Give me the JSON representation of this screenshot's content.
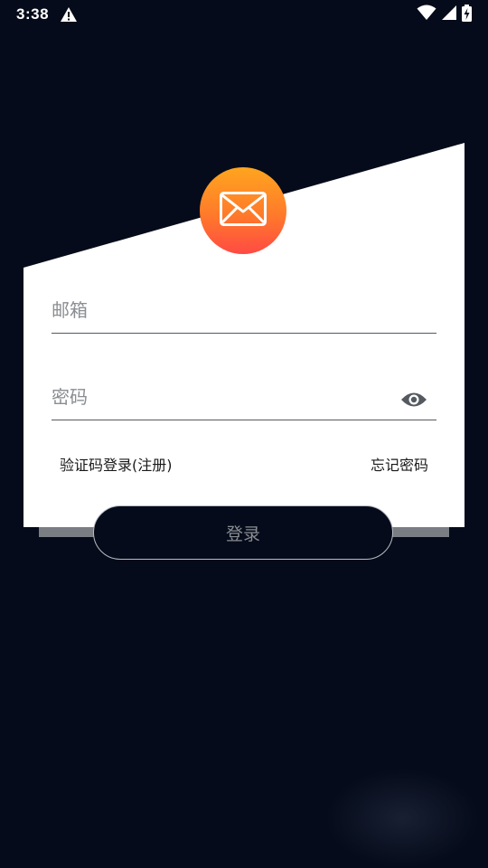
{
  "status_bar": {
    "time": "3:38",
    "icons": [
      "warning-icon",
      "wifi-icon",
      "signal-icon",
      "battery-charging-icon"
    ]
  },
  "header": {
    "avatar_icon": "envelope-icon"
  },
  "form": {
    "email": {
      "placeholder": "邮箱",
      "value": ""
    },
    "password": {
      "placeholder": "密码",
      "value": "",
      "toggle_icon": "eye-icon"
    },
    "code_login_link": "验证码登录(注册)",
    "forgot_password_link": "忘记密码",
    "login_button": "登录"
  },
  "colors": {
    "background": "#050b1a",
    "card": "#ffffff",
    "avatar_gradient_top": "#ffa51f",
    "avatar_gradient_bottom": "#ff4a44",
    "button_text": "#8a8d93"
  }
}
